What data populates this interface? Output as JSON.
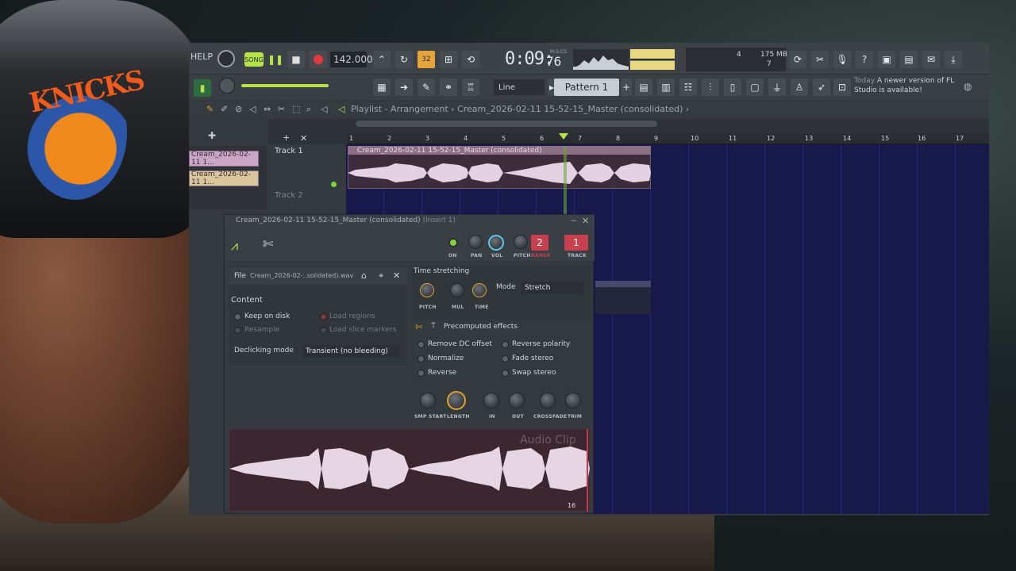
{
  "toolbar": {
    "help_label": "HELP",
    "song_label": "SONG",
    "tempo": "142.000",
    "time_main": "0:09:",
    "time_frac": "76",
    "time_label": "M:S:CS",
    "cpu_value": "4",
    "memory": "175 MB",
    "polyphony": "7",
    "snap_mode": "Line",
    "pattern_label": "Pattern 1",
    "news_label": "Today",
    "news_text": "A newer version of FL Studio is available!"
  },
  "playlist": {
    "title": "Playlist - Arrangement",
    "breadcrumb_clip": "Cream_2026-02-11 15-52-15_Master (consolidated)",
    "ruler_ticks": [
      "1",
      "2",
      "3",
      "4",
      "5",
      "6",
      "7",
      "8",
      "9",
      "10",
      "11",
      "12",
      "13",
      "14",
      "15",
      "16",
      "17"
    ],
    "tracks": [
      "Track 1",
      "Track 2"
    ],
    "clip_title": "Cream_2026-02-11 15-52-15_Master (consolidated)",
    "picker_clips": [
      "Cream_2026-02-11 1...",
      "Cream_2026-02-11 1..."
    ]
  },
  "channel_settings": {
    "title": "Cream_2026-02-11 15-52-15_Master (consolidated)",
    "insert": "(Insert 1)",
    "knobs_top": [
      "ON",
      "PAN",
      "VOL",
      "PITCH",
      "RANGE",
      "TRACK"
    ],
    "range_value": "2",
    "track_value": "1",
    "file_label": "File",
    "file_name": "Cream_2026-02-..solidated).wav",
    "content_header": "Content",
    "keep_on_disk": "Keep on disk",
    "resample": "Resample",
    "load_regions": "Load regions",
    "load_slice_markers": "Load slice markers",
    "declicking_label": "Declicking mode",
    "declicking_value": "Transient (no bleeding)",
    "time_stretching_header": "Time stretching",
    "ts_knobs": [
      "PITCH",
      "MUL",
      "TIME"
    ],
    "mode_label": "Mode",
    "mode_value": "Stretch",
    "precomputed_header": "Precomputed effects",
    "effects_left": [
      "Remove DC offset",
      "Normalize",
      "Reverse"
    ],
    "effects_right": [
      "Reverse polarity",
      "Fade stereo",
      "Swap stereo"
    ],
    "bottom_knobs": [
      "SMP START",
      "LENGTH",
      "IN",
      "OUT",
      "CROSSFADE",
      "TRIM"
    ],
    "preview_label": "Audio Clip",
    "preview_count": "16"
  },
  "colors": {
    "accent_green": "#b8e24a",
    "range_red": "#c8404e",
    "grid_blue": "#16194a",
    "clip_pink": "#e4d2e2"
  }
}
